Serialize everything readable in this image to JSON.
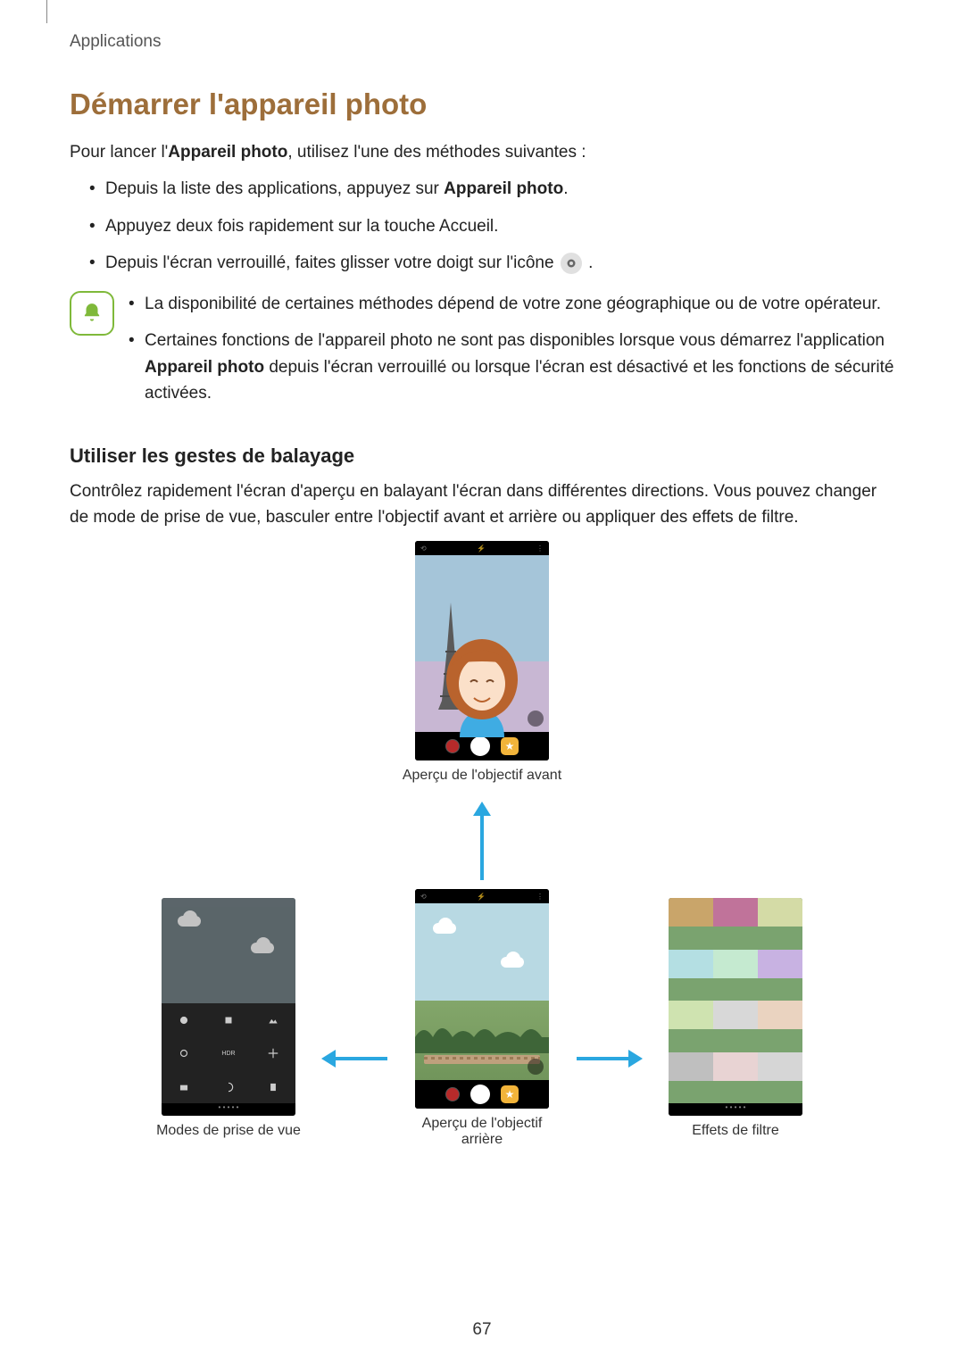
{
  "breadcrumb": "Applications",
  "h1": "Démarrer l'appareil photo",
  "intro_pre": "Pour lancer l'",
  "intro_bold": "Appareil photo",
  "intro_post": ", utilisez l'une des méthodes suivantes :",
  "bullets": {
    "b1_pre": "Depuis la liste des applications, appuyez sur ",
    "b1_bold": "Appareil photo",
    "b1_post": ".",
    "b2": "Appuyez deux fois rapidement sur la touche Accueil.",
    "b3_pre": "Depuis l'écran verrouillé, faites glisser votre doigt sur l'icône ",
    "b3_post": " ."
  },
  "note": {
    "n1": "La disponibilité de certaines méthodes dépend de votre zone géographique ou de votre opérateur.",
    "n2_pre": "Certaines fonctions de l'appareil photo ne sont pas disponibles lorsque vous démarrez l'application ",
    "n2_bold": "Appareil photo",
    "n2_post": " depuis l'écran verrouillé ou lorsque l'écran est désactivé et les fonctions de sécurité activées."
  },
  "h2": "Utiliser les gestes de balayage",
  "swipe_intro": "Contrôlez rapidement l'écran d'aperçu en balayant l'écran dans différentes directions. Vous pouvez changer de mode de prise de vue, basculer entre l'objectif avant et arrière ou appliquer des effets de filtre.",
  "captions": {
    "front": "Aperçu de l'objectif avant",
    "rear": "Aperçu de l'objectif arrière",
    "modes": "Modes de prise de vue",
    "filters": "Effets de filtre"
  },
  "topbar": {
    "left": "⟲",
    "mid": "⚡",
    "right": "⋮"
  },
  "star_glyph": "★",
  "page_number": "67"
}
